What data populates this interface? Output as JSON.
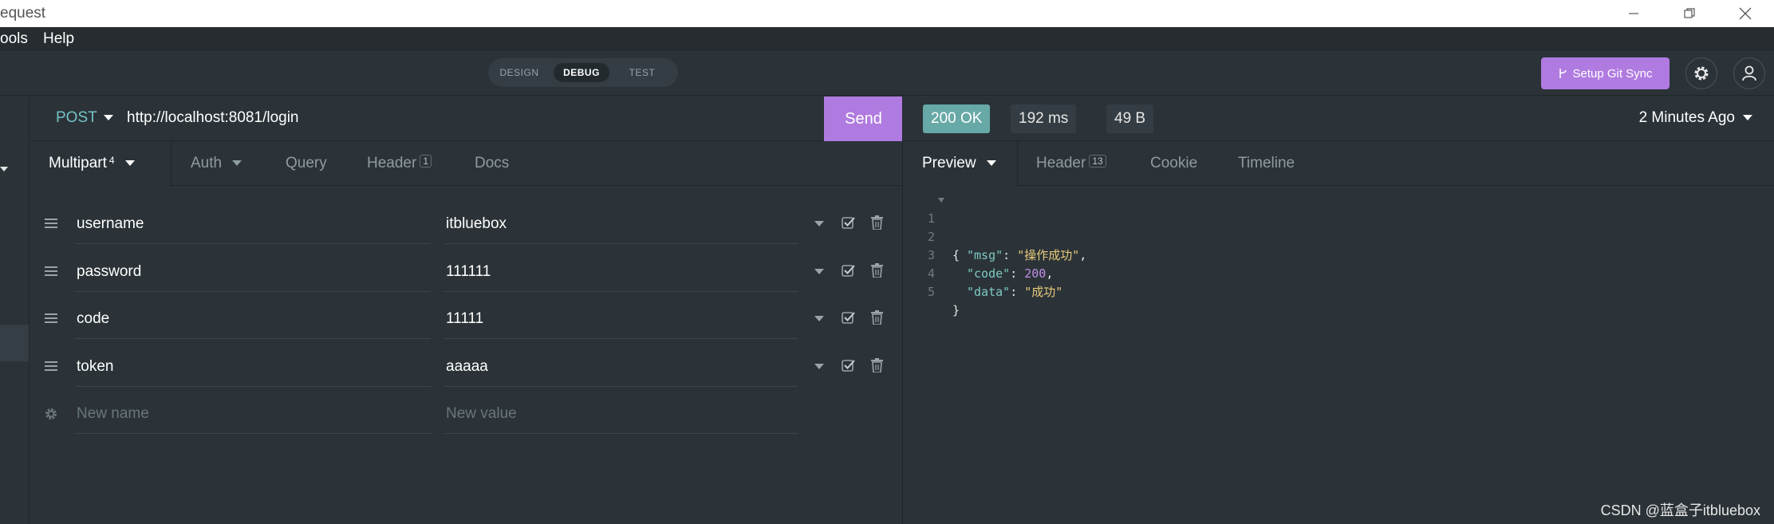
{
  "window": {
    "title": "Request",
    "title_visible": "equest",
    "controls": [
      "minimize",
      "restore",
      "close"
    ]
  },
  "menu": {
    "items": [
      "Tools",
      "Help"
    ],
    "items_visible": [
      "ools",
      "Help"
    ]
  },
  "toolbar": {
    "modes": [
      "DESIGN",
      "DEBUG",
      "TEST"
    ],
    "active_mode": "DEBUG",
    "git_sync_label": "Setup Git Sync"
  },
  "request": {
    "method": "POST",
    "url": "http://localhost:8081/login",
    "send_label": "Send",
    "tabs": [
      {
        "label": "Multipart",
        "count": "4",
        "active": true
      },
      {
        "label": "Auth"
      },
      {
        "label": "Query"
      },
      {
        "label": "Header",
        "count": "1"
      },
      {
        "label": "Docs"
      }
    ],
    "params": [
      {
        "name": "username",
        "value": "itbluebox"
      },
      {
        "name": "password",
        "value": "111111"
      },
      {
        "name": "code",
        "value": "11111"
      },
      {
        "name": "token",
        "value": "aaaaa"
      }
    ],
    "new_name_placeholder": "New name",
    "new_value_placeholder": "New value"
  },
  "response": {
    "status": "200 OK",
    "time": "192 ms",
    "size": "49 B",
    "when": "2 Minutes Ago",
    "tabs": [
      {
        "label": "Preview",
        "active": true
      },
      {
        "label": "Header",
        "count": "13"
      },
      {
        "label": "Cookie"
      },
      {
        "label": "Timeline"
      }
    ],
    "body_lines": [
      {
        "no": "1",
        "text": "{"
      },
      {
        "no": "2",
        "key": "\"msg\"",
        "val": "\"操作成功\"",
        "type": "string"
      },
      {
        "no": "3",
        "key": "\"code\"",
        "val": "200",
        "type": "number"
      },
      {
        "no": "4",
        "key": "\"data\"",
        "val": "\"成功\"",
        "type": "string",
        "last": true
      },
      {
        "no": "5",
        "text": "}"
      }
    ]
  },
  "watermark": "CSDN @蓝盒子itbluebox",
  "colors": {
    "background": "#2b3338",
    "accent": "#b07be0",
    "status_ok": "#67a9a6",
    "method": "#74c3c7"
  }
}
